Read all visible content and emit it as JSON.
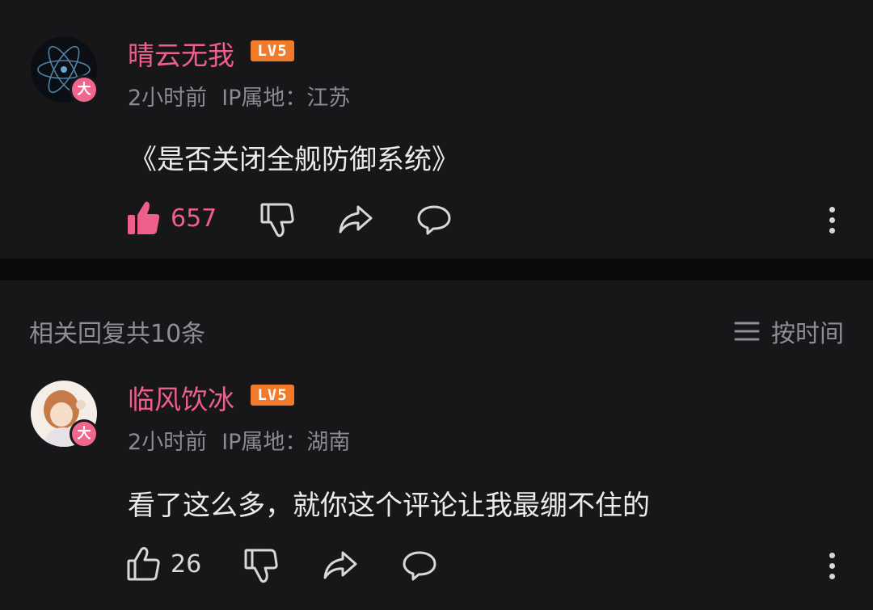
{
  "comment1": {
    "username": "晴云无我",
    "level": "LV5",
    "avatar_badge": "大",
    "time": "2小时前",
    "ip": "IP属地：江苏",
    "text": "《是否关闭全舰防御系统》",
    "likes": "657",
    "liked": true
  },
  "replies_header": {
    "title": "相关回复共10条",
    "sort_label": "按时间"
  },
  "comment2": {
    "username": "临风饮冰",
    "level": "LV5",
    "avatar_badge": "大",
    "time": "2小时前",
    "ip": "IP属地：湖南",
    "text": "看了这么多，就你这个评论让我最绷不住的",
    "likes": "26",
    "liked": false
  },
  "colors": {
    "accent_pink": "#ee5f8a",
    "level_orange": "#f27a2b",
    "background": "#17171a"
  },
  "icons": [
    "thumb-up-icon",
    "thumb-down-icon",
    "share-icon",
    "comment-icon",
    "more-icon",
    "sort-icon"
  ]
}
